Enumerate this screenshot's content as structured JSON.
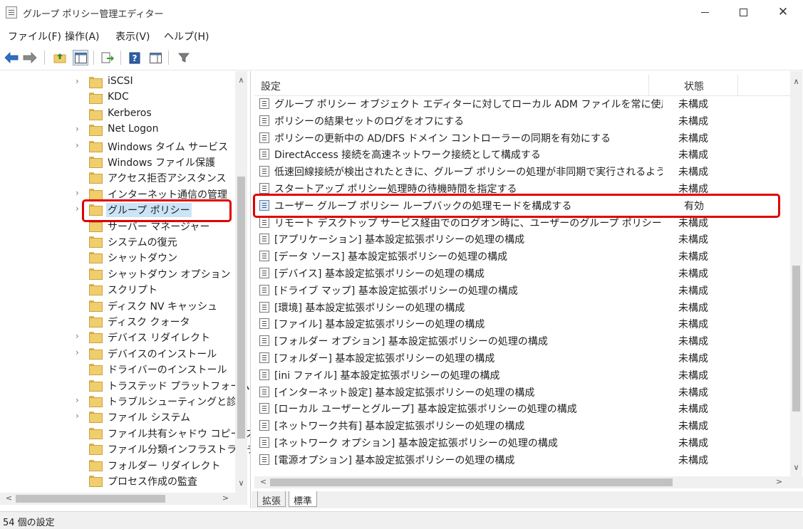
{
  "window": {
    "title": "グループ ポリシー管理エディター",
    "minimize_icon": "minimize-icon",
    "maximize_icon": "maximize-icon",
    "close_icon": "close-icon",
    "close_glyph": "✕"
  },
  "menu": [
    {
      "label": "ファイル(F)"
    },
    {
      "label": "操作(A)"
    },
    {
      "label": "表示(V)"
    },
    {
      "label": "ヘルプ(H)"
    }
  ],
  "toolbar": {
    "icons": [
      "back-arrow-icon",
      "forward-arrow-icon",
      "up-folder-icon",
      "show-hide-tree-icon",
      "export-list-icon",
      "help-icon",
      "properties-pane-icon",
      "filter-icon"
    ]
  },
  "tree": {
    "items": [
      {
        "label": "iSCSI",
        "expandable": true
      },
      {
        "label": "KDC",
        "expandable": false
      },
      {
        "label": "Kerberos",
        "expandable": false
      },
      {
        "label": "Net Logon",
        "expandable": true
      },
      {
        "label": "Windows タイム サービス",
        "expandable": true
      },
      {
        "label": "Windows ファイル保護",
        "expandable": false
      },
      {
        "label": "アクセス拒否アシスタンス",
        "expandable": false
      },
      {
        "label": "インターネット通信の管理",
        "expandable": true
      },
      {
        "label": "グループ ポリシー",
        "expandable": true,
        "selected": true
      },
      {
        "label": "サーバー マネージャー",
        "expandable": false
      },
      {
        "label": "システムの復元",
        "expandable": false
      },
      {
        "label": "シャットダウン",
        "expandable": false
      },
      {
        "label": "シャットダウン オプション",
        "expandable": false
      },
      {
        "label": "スクリプト",
        "expandable": false
      },
      {
        "label": "ディスク NV キャッシュ",
        "expandable": false
      },
      {
        "label": "ディスク クォータ",
        "expandable": false
      },
      {
        "label": "デバイス リダイレクト",
        "expandable": true
      },
      {
        "label": "デバイスのインストール",
        "expandable": true
      },
      {
        "label": "ドライバーのインストール",
        "expandable": false
      },
      {
        "label": "トラステッド プラットフォーム モジ",
        "expandable": false
      },
      {
        "label": "トラブルシューティングと診断",
        "expandable": true
      },
      {
        "label": "ファイル システム",
        "expandable": true
      },
      {
        "label": "ファイル共有シャドウ コピー プロ",
        "expandable": false
      },
      {
        "label": "ファイル分類インフラストラクチャ",
        "expandable": false
      },
      {
        "label": "フォルダー リダイレクト",
        "expandable": false
      },
      {
        "label": "プロセス作成の監査",
        "expandable": false
      }
    ]
  },
  "list": {
    "headers": {
      "setting": "設定",
      "state": "状態"
    },
    "rows": [
      {
        "name": "グループ ポリシー オブジェクト エディターに対してローカル ADM ファイルを常に使用する",
        "state": "未構成"
      },
      {
        "name": "ポリシーの結果セットのログをオフにする",
        "state": "未構成"
      },
      {
        "name": "ポリシーの更新中の AD/DFS ドメイン コントローラーの同期を有効にする",
        "state": "未構成"
      },
      {
        "name": "DirectAccess 接続を高速ネットワーク接続として構成する",
        "state": "未構成"
      },
      {
        "name": "低速回線接続が検出されたときに、グループ ポリシーの処理が非同期で実行されるよう...",
        "state": "未構成"
      },
      {
        "name": "スタートアップ ポリシー処理時の待機時間を指定する",
        "state": "未構成"
      },
      {
        "name": "ユーザー グループ ポリシー ループバックの処理モードを構成する",
        "state": "有効",
        "enabled": true
      },
      {
        "name": "リモート デスクトップ サービス経由でのログオン時に、ユーザーのグループ ポリシーを非同期に...",
        "state": "未構成"
      },
      {
        "name": "[アプリケーション] 基本設定拡張ポリシーの処理の構成",
        "state": "未構成"
      },
      {
        "name": "[データ ソース] 基本設定拡張ポリシーの処理の構成",
        "state": "未構成"
      },
      {
        "name": "[デバイス] 基本設定拡張ポリシーの処理の構成",
        "state": "未構成"
      },
      {
        "name": "[ドライブ マップ] 基本設定拡張ポリシーの処理の構成",
        "state": "未構成"
      },
      {
        "name": "[環境] 基本設定拡張ポリシーの処理の構成",
        "state": "未構成"
      },
      {
        "name": "[ファイル] 基本設定拡張ポリシーの処理の構成",
        "state": "未構成"
      },
      {
        "name": "[フォルダー オプション] 基本設定拡張ポリシーの処理の構成",
        "state": "未構成"
      },
      {
        "name": "[フォルダー] 基本設定拡張ポリシーの処理の構成",
        "state": "未構成"
      },
      {
        "name": "[ini ファイル] 基本設定拡張ポリシーの処理の構成",
        "state": "未構成"
      },
      {
        "name": "[インターネット設定] 基本設定拡張ポリシーの処理の構成",
        "state": "未構成"
      },
      {
        "name": "[ローカル ユーザーとグループ] 基本設定拡張ポリシーの処理の構成",
        "state": "未構成"
      },
      {
        "name": "[ネットワーク共有] 基本設定拡張ポリシーの処理の構成",
        "state": "未構成"
      },
      {
        "name": "[ネットワーク オプション] 基本設定拡張ポリシーの処理の構成",
        "state": "未構成"
      },
      {
        "name": "[電源オプション] 基本設定拡張ポリシーの処理の構成",
        "state": "未構成"
      }
    ]
  },
  "tabs": [
    {
      "label": "拡張"
    },
    {
      "label": "標準",
      "active": true
    }
  ],
  "status": {
    "text": "54 個の設定"
  },
  "colors": {
    "highlight": "#e00000",
    "selection": "#cce4f7"
  }
}
